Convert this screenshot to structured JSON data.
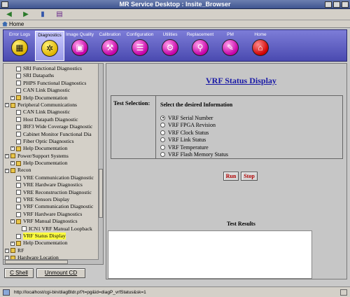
{
  "window": {
    "title": "MR Service Desktop : Insite_Browser"
  },
  "homebar": {
    "home_label": "Home"
  },
  "toolbar": {
    "items": [
      {
        "label": "Error Logs",
        "icon": "error-logs-icon",
        "glyph": "▦"
      },
      {
        "label": "Diagnostics",
        "icon": "diagnostics-icon",
        "glyph": "✲"
      },
      {
        "label": "Image Quality",
        "icon": "image-quality-icon",
        "glyph": "▣"
      },
      {
        "label": "Calibration",
        "icon": "calibration-icon",
        "glyph": "⚒"
      },
      {
        "label": "Configuration",
        "icon": "configuration-icon",
        "glyph": "☰"
      },
      {
        "label": "Utilities",
        "icon": "utilities-icon",
        "glyph": "⚙"
      },
      {
        "label": "Replacement",
        "icon": "replacement-icon",
        "glyph": "⚲"
      },
      {
        "label": "PM",
        "icon": "pm-icon",
        "glyph": "✎"
      },
      {
        "label": "Home",
        "icon": "home-icon",
        "glyph": "⌂"
      }
    ],
    "active_index": 1
  },
  "tree": {
    "items": [
      {
        "label": "SRI Functional Diagnostics",
        "indent": 2,
        "type": "file"
      },
      {
        "label": "SRI Datapaths",
        "indent": 2,
        "type": "file"
      },
      {
        "label": "PHPS Functional Diagnostics",
        "indent": 2,
        "type": "file"
      },
      {
        "label": "CAN Link Diagnostic",
        "indent": 2,
        "type": "file"
      },
      {
        "label": "Help Documentation",
        "indent": 1,
        "type": "folder"
      },
      {
        "label": "Peripheral Communications",
        "indent": 0,
        "type": "folder"
      },
      {
        "label": "CAN Link Diagnostic",
        "indent": 2,
        "type": "file"
      },
      {
        "label": "Host Datapath Diagnostic",
        "indent": 2,
        "type": "file"
      },
      {
        "label": "IRF3 Wide Coverage Diagnostic",
        "indent": 2,
        "type": "file"
      },
      {
        "label": "Cabinet Monitor Functional Dia",
        "indent": 2,
        "type": "file"
      },
      {
        "label": "Fiber Optic Diagnostics",
        "indent": 2,
        "type": "file"
      },
      {
        "label": "Help Documentation",
        "indent": 1,
        "type": "folder"
      },
      {
        "label": "Power/Support Systems",
        "indent": 0,
        "type": "folder"
      },
      {
        "label": "Help Documentation",
        "indent": 1,
        "type": "folder"
      },
      {
        "label": "Recon",
        "indent": 0,
        "type": "folder"
      },
      {
        "label": "VRE Communication Diagnostic",
        "indent": 2,
        "type": "file"
      },
      {
        "label": "VRE Hardware Diagnostics",
        "indent": 2,
        "type": "file"
      },
      {
        "label": "VRE Reconstruction Diagnostic",
        "indent": 2,
        "type": "file"
      },
      {
        "label": "VRE Sensors Display",
        "indent": 2,
        "type": "file"
      },
      {
        "label": "VRF Communication Diagnostic",
        "indent": 2,
        "type": "file"
      },
      {
        "label": "VRF Hardware Diagnostics",
        "indent": 2,
        "type": "file"
      },
      {
        "label": "VRF Manual Diagnostics",
        "indent": 1,
        "type": "folder"
      },
      {
        "label": "ICN1 VRF Manual Loopback",
        "indent": 3,
        "type": "file"
      },
      {
        "label": "VRF Status Display",
        "indent": 2,
        "type": "file",
        "selected": true
      },
      {
        "label": "Help Documentation",
        "indent": 1,
        "type": "folder"
      },
      {
        "label": "RF",
        "indent": 0,
        "type": "folder"
      },
      {
        "label": "Hardware Location",
        "indent": 0,
        "type": "folder"
      }
    ]
  },
  "bottom_buttons": {
    "shell": "C Shell",
    "unmount": "Unmount CD"
  },
  "content": {
    "title": "VRF Status Display",
    "test_selection_label": "Test Selection:",
    "desired_label": "Select the desired Information",
    "options": [
      {
        "label": "VRF Serial Number",
        "checked": true
      },
      {
        "label": "VRF FPGA Revision",
        "checked": false
      },
      {
        "label": "VRF Clock Status",
        "checked": false
      },
      {
        "label": "VRF Link Status",
        "checked": false
      },
      {
        "label": "VRF Temperature",
        "checked": false
      },
      {
        "label": "VRF Flash Memory Status",
        "checked": false
      }
    ],
    "run_label": "Run",
    "stop_label": "Stop",
    "results_label": "Test Results"
  },
  "statusbar": {
    "url": "http://localhost/cgi-bin/diagBldr.pl?t=pg&id=diagP_vrfStatus&sk=1"
  },
  "colors": {
    "toolbar": "#5a5ac4",
    "active_tool": "#b4b4f4",
    "link_title": "#1a1aa6",
    "selected_tree": "#ffff40",
    "run_stop_text": "#b00000"
  }
}
